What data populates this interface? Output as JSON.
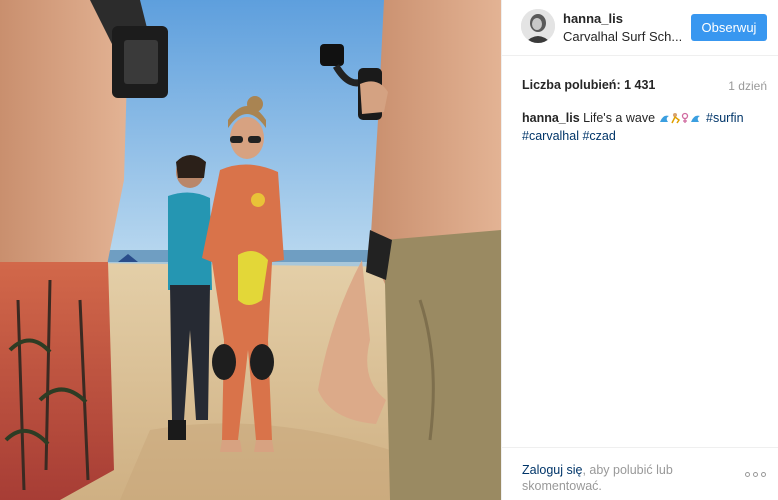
{
  "post": {
    "username": "hanna_lis",
    "location": "Carvalhal Surf Sch...",
    "follow_label": "Obserwuj",
    "likes_label": "Liczba polubień: 1 431",
    "age": "1 dzień",
    "caption": {
      "user": "hanna_lis",
      "text": "Life's a wave",
      "tag1": "#surfin",
      "tag2": "#carvalhal",
      "tag3": "#czad"
    },
    "login_link": "Zaloguj się",
    "login_rest": ", aby polubić lub skomentować."
  },
  "colors": {
    "accent": "#3897f0",
    "link": "#003569",
    "muted": "#999999",
    "text": "#262626"
  },
  "icons": {
    "more": "more-options-icon",
    "emoji": "wave-surfer-emoji-icons"
  }
}
